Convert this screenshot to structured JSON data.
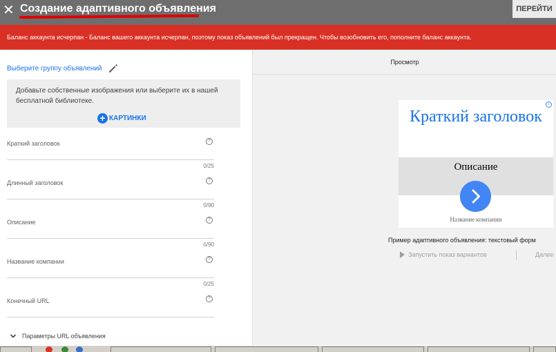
{
  "header": {
    "title": "Создание адаптивного объявления",
    "goto_label": "ПЕРЕЙТИ"
  },
  "alert": {
    "text": "Баланс аккаунта исчерпан - Баланс вашего аккаунта исчерпан, поэтому показ объявлений был прекращен. Чтобы возобновить его, пополните баланс аккаунта."
  },
  "form": {
    "ad_group_link": "Выберите группу объявлений",
    "images_hint": "Добавьте собственные изображения или выберите их в нашей бесплатной библиотеке.",
    "images_button": "КАРТИНКИ",
    "fields": [
      {
        "label": "Краткий заголовок",
        "counter": "0/25"
      },
      {
        "label": "Длинный заголовок",
        "counter": "0/90"
      },
      {
        "label": "Описание",
        "counter": "0/90"
      },
      {
        "label": "Название компании",
        "counter": "0/25"
      },
      {
        "label": "Конечный URL",
        "counter": ""
      }
    ],
    "url_params_label": "Параметры URL объявления"
  },
  "preview": {
    "header": "Просмотр",
    "ad": {
      "title": "Краткий заголовок",
      "description": "Описание",
      "company": "Название компании"
    },
    "caption": "Пример адаптивного объявления: текстовый форм",
    "run_label": "Запустить показ вариантов",
    "next_label": "Далее"
  },
  "colors": {
    "accent": "#1a73e8",
    "alert_bg": "#d93025",
    "topbar_bg": "#6e6e6e"
  }
}
